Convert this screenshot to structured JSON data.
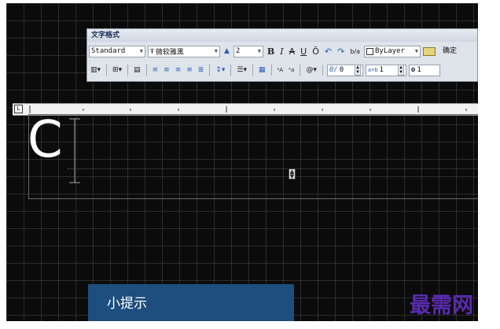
{
  "dialog": {
    "title": "文字格式",
    "style_value": "Standard",
    "font_value": "微软雅黑",
    "font_icon": "truetype-font-icon",
    "height_value": "2",
    "bold_label": "B",
    "italic_label": "I",
    "strike_label": "A",
    "underline_label": "U",
    "overline_label": "Ō",
    "undo_label": "↶",
    "redo_label": "↷",
    "stack_label": "b/a",
    "color_value": "ByLayer",
    "ok_label": "确定",
    "oblique_value": "0",
    "tracking_value": "1",
    "width_value": "1",
    "tracking_prefix": "a+b",
    "oblique_prefix": "0/",
    "width_prefix": "o"
  },
  "ruler": {
    "corner_label": "L"
  },
  "editor": {
    "typed_text": "C"
  },
  "tip": {
    "label": "小提示"
  },
  "watermark": {
    "text": "最需网"
  },
  "colors": {
    "canvas": "#0b0b0b",
    "tip_panel": "#1d4e7e",
    "watermark": "#5a2bb0"
  }
}
